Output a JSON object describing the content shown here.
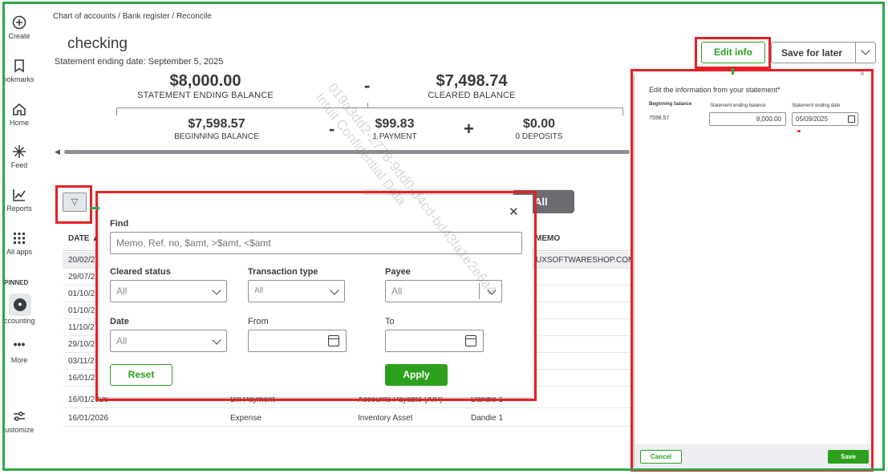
{
  "nav": {
    "items": [
      {
        "label": "Create"
      },
      {
        "label": "Bookmarks"
      },
      {
        "label": "Home"
      },
      {
        "label": "Feed"
      },
      {
        "label": "Reports"
      },
      {
        "label": "All apps"
      },
      {
        "label": "Accounting"
      },
      {
        "label": "More"
      },
      {
        "label": "Customize"
      }
    ],
    "pinned_label": "PINNED"
  },
  "breadcrumb": "Chart of accounts  /  Bank register  /  Reconcile",
  "account_title": "checking",
  "statement_date": "Statement ending date: September 5, 2025",
  "summary": {
    "ending_balance": {
      "amount": "$8,000.00",
      "label": "STATEMENT ENDING BALANCE"
    },
    "cleared_balance": {
      "amount": "$7,498.74",
      "label": "CLEARED BALANCE"
    },
    "beginning_balance": {
      "amount": "$7,598.57",
      "label": "BEGINNING BALANCE"
    },
    "payments": {
      "amount": "$99.83",
      "label": "1 PAYMENT"
    },
    "deposits": {
      "amount": "$0.00",
      "label": "0 DEPOSITS"
    },
    "op_minus": "-",
    "op_plus": "+"
  },
  "toggle": {
    "all_label": "All"
  },
  "table": {
    "headers": {
      "date": "DATE ▲",
      "memo": "MEMO"
    },
    "rows": [
      {
        "date": "20/02/2",
        "type": "",
        "account": "",
        "payee": "",
        "memo": "UXSOFTWARESHOP.COM"
      },
      {
        "date": "29/07/2",
        "type": "",
        "account": "",
        "payee": "",
        "memo": ""
      },
      {
        "date": "01/10/2",
        "type": "",
        "account": "",
        "payee": "",
        "memo": ""
      },
      {
        "date": "01/10/2",
        "type": "",
        "account": "",
        "payee": "",
        "memo": ""
      },
      {
        "date": "11/10/2",
        "type": "",
        "account": "",
        "payee": "",
        "memo": ""
      },
      {
        "date": "29/10/2",
        "type": "",
        "account": "",
        "payee": "",
        "memo": ""
      },
      {
        "date": "03/11/2",
        "type": "",
        "account": "",
        "payee": "",
        "memo": ""
      },
      {
        "date": "16/01/2",
        "type": "",
        "account": "",
        "payee": "",
        "memo": ""
      },
      {
        "date": "16/01/2026",
        "type": "Bill Payment",
        "account": "Accounts Payable (A/P)",
        "payee": "Dandie 1",
        "memo": ""
      },
      {
        "date": "16/01/2026",
        "type": "Expense",
        "account": "Inventory Asset",
        "payee": "Dandie 1",
        "memo": ""
      }
    ]
  },
  "filter_popup": {
    "find_label": "Find",
    "find_placeholder": "Memo, Ref. no, $amt, >$amt, <$amt",
    "cleared_status_label": "Cleared status",
    "cleared_status_value": "All",
    "transaction_type_label": "Transaction type",
    "transaction_type_value": "All",
    "payee_label": "Payee",
    "payee_value": "All",
    "date_label": "Date",
    "date_value": "All",
    "from_label": "From",
    "to_label": "To",
    "reset_label": "Reset",
    "apply_label": "Apply",
    "close_glyph": "✕"
  },
  "header_buttons": {
    "edit_info": "Edit info",
    "save_for_later": "Save for later"
  },
  "edit_panel": {
    "title": "Edit the information from your statement*",
    "beginning_balance_label": "Beginning balance",
    "beginning_balance_value": "7598.57",
    "ending_balance_label": "Statement ending balance",
    "ending_balance_value": "8,000.00",
    "ending_date_label": "Statement ending date",
    "ending_date_value": "05/09/2025",
    "cancel_label": "Cancel",
    "save_label": "Save",
    "close_glyph": "✕"
  },
  "watermark": {
    "line1": "019a3dd2-2778-9dd0-d4cd-bd43fa1e2e6a4",
    "line2": "Intuit Confidential Data"
  },
  "colors": {
    "brand_green": "#2ca01c",
    "annotation_red": "#e42127",
    "annotation_green": "#2ea844",
    "text_dark": "#393a3d"
  }
}
